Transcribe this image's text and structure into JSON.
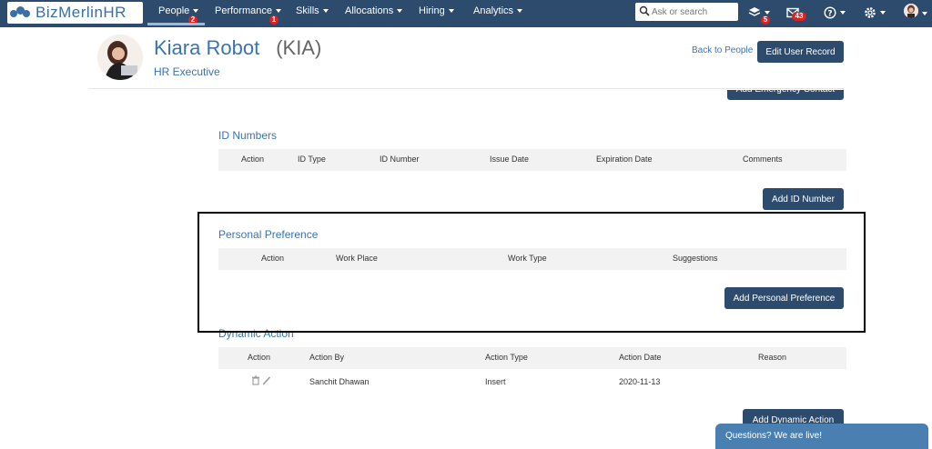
{
  "app": {
    "logo_text": "BizMerlinHR"
  },
  "nav": {
    "items": [
      {
        "label": "People",
        "badge": "2"
      },
      {
        "label": "Performance",
        "badge": "1"
      },
      {
        "label": "Skills"
      },
      {
        "label": "Allocations"
      },
      {
        "label": "Hiring"
      },
      {
        "label": "Analytics"
      }
    ],
    "search_placeholder": "Ask or search",
    "learning_badge": "5",
    "messages_badge": "43"
  },
  "profile": {
    "name": "Kiara Robot",
    "code": "(KIA)",
    "role": "HR Executive",
    "back_link": "Back to People",
    "edit_button": "Edit User Record"
  },
  "emergency": {
    "button": "Add Emergency Contact"
  },
  "id_numbers": {
    "title": "ID Numbers",
    "columns": [
      "Action",
      "ID Type",
      "ID Number",
      "Issue Date",
      "Expiration Date",
      "Comments"
    ],
    "add_button": "Add ID Number"
  },
  "personal_preference": {
    "title": "Personal Preference",
    "columns": [
      "Action",
      "Work Place",
      "Work Type",
      "Suggestions"
    ],
    "add_button": "Add Personal Preference"
  },
  "dynamic_action": {
    "title": "Dynamic Action",
    "columns": [
      "Action",
      "Action By",
      "Action Type",
      "Action Date",
      "Reason"
    ],
    "rows": [
      {
        "action_by": "Sanchit Dhawan",
        "action_type": "Insert",
        "action_date": "2020-11-13",
        "reason": ""
      }
    ],
    "add_button": "Add Dynamic Action"
  },
  "chat": {
    "label": "Questions? We are live!"
  },
  "colors": {
    "topbar": "#2d4b6c",
    "accent": "#3a73b0",
    "button": "#2d4b6c",
    "badge": "#dd2222"
  }
}
